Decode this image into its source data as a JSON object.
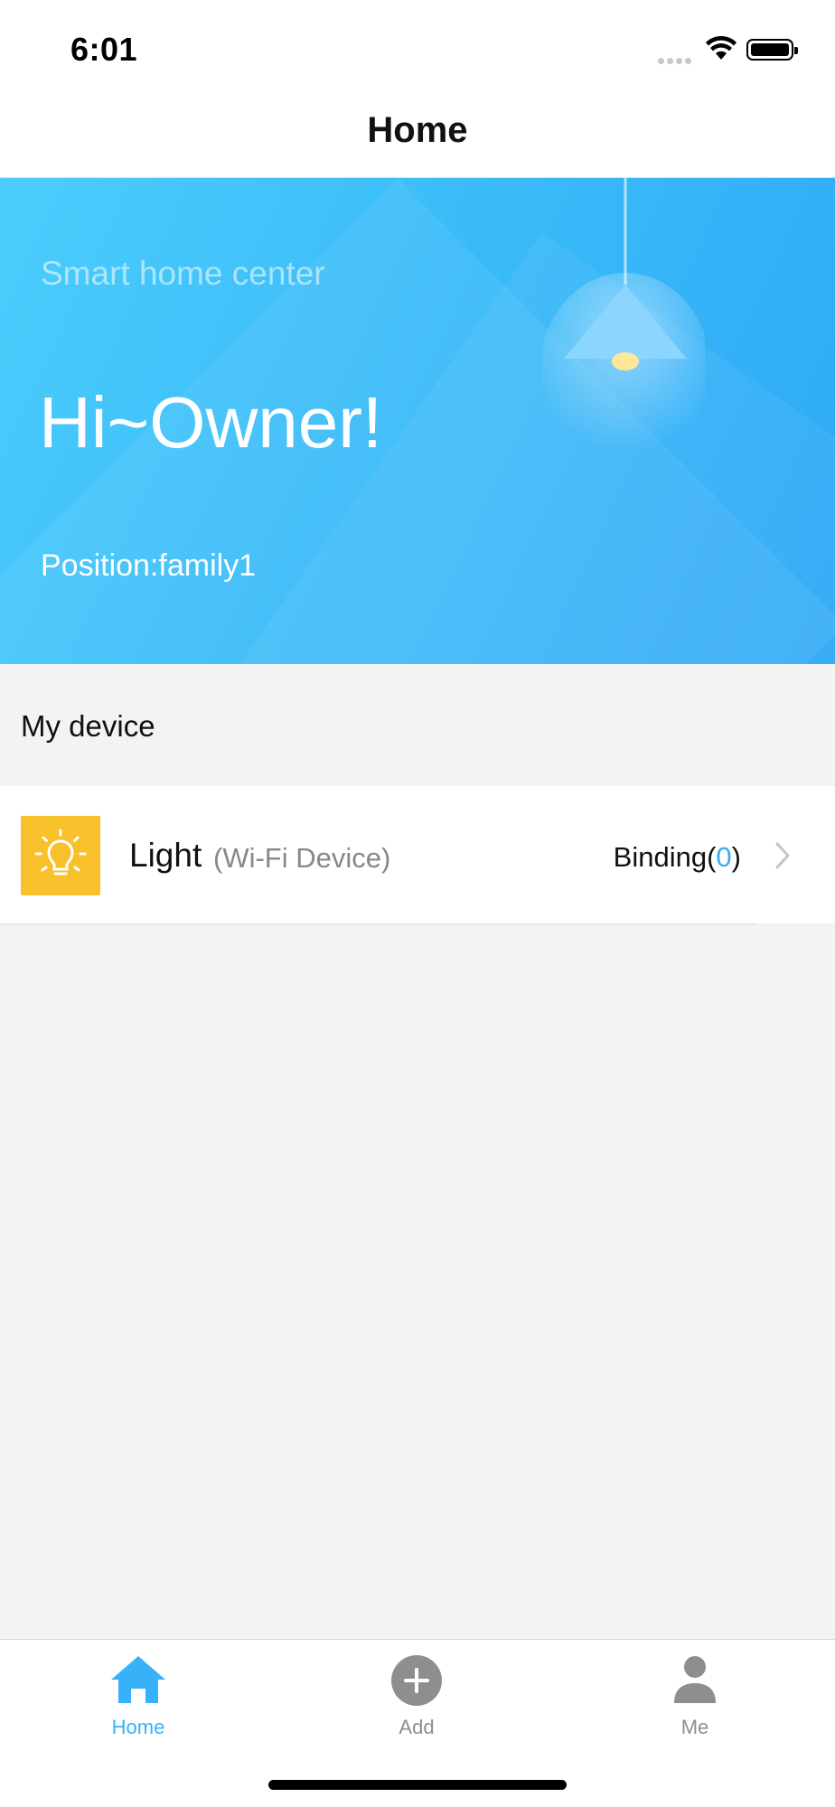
{
  "status_bar": {
    "time": "6:01"
  },
  "nav": {
    "title": "Home"
  },
  "banner": {
    "subtitle": "Smart home center",
    "greeting": "Hi~Owner!",
    "position": "Position:family1"
  },
  "section": {
    "label": "My device"
  },
  "device": {
    "name": "Light",
    "type": "(Wi-Fi Device)",
    "binding_prefix": "Binding(",
    "binding_count": "0",
    "binding_suffix": ")",
    "icon": "lightbulb-icon"
  },
  "tabs": [
    {
      "label": "Home",
      "icon": "home-icon",
      "active": true
    },
    {
      "label": "Add",
      "icon": "add-icon",
      "active": false
    },
    {
      "label": "Me",
      "icon": "person-icon",
      "active": false
    }
  ],
  "colors": {
    "accent": "#37b1f8",
    "banner_start": "#4ccdfc",
    "banner_end": "#2ea8f7",
    "device_icon_bg": "#f8c02a",
    "inactive_tab": "#8e8e8e"
  }
}
